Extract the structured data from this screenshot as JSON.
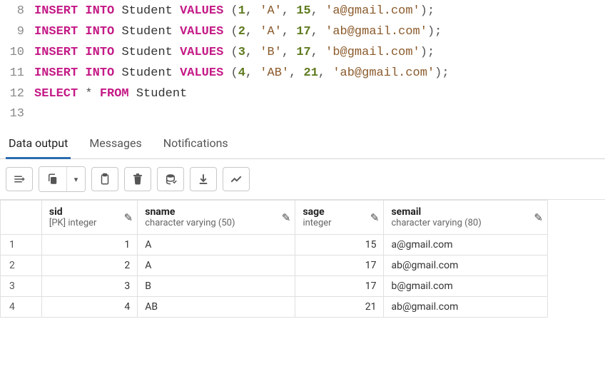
{
  "editor": {
    "lines": [
      {
        "n": 8,
        "tokens": [
          {
            "t": "INSERT",
            "c": "kw"
          },
          {
            "t": " "
          },
          {
            "t": "INTO",
            "c": "kw"
          },
          {
            "t": " "
          },
          {
            "t": "Student",
            "c": "ident"
          },
          {
            "t": " "
          },
          {
            "t": "VALUES",
            "c": "kw"
          },
          {
            "t": " "
          },
          {
            "t": "(",
            "c": "punct"
          },
          {
            "t": "1",
            "c": "num"
          },
          {
            "t": ", ",
            "c": "punct"
          },
          {
            "t": "'A'",
            "c": "str"
          },
          {
            "t": ", ",
            "c": "punct"
          },
          {
            "t": "15",
            "c": "num"
          },
          {
            "t": ", ",
            "c": "punct"
          },
          {
            "t": "'a@gmail.com'",
            "c": "str"
          },
          {
            "t": ")",
            "c": "punct"
          },
          {
            "t": ";",
            "c": "punct"
          }
        ]
      },
      {
        "n": 9,
        "tokens": [
          {
            "t": "INSERT",
            "c": "kw"
          },
          {
            "t": " "
          },
          {
            "t": "INTO",
            "c": "kw"
          },
          {
            "t": " "
          },
          {
            "t": "Student",
            "c": "ident"
          },
          {
            "t": " "
          },
          {
            "t": "VALUES",
            "c": "kw"
          },
          {
            "t": " "
          },
          {
            "t": "(",
            "c": "punct"
          },
          {
            "t": "2",
            "c": "num"
          },
          {
            "t": ", ",
            "c": "punct"
          },
          {
            "t": "'A'",
            "c": "str"
          },
          {
            "t": ", ",
            "c": "punct"
          },
          {
            "t": "17",
            "c": "num"
          },
          {
            "t": ", ",
            "c": "punct"
          },
          {
            "t": "'ab@gmail.com'",
            "c": "str"
          },
          {
            "t": ")",
            "c": "punct"
          },
          {
            "t": ";",
            "c": "punct"
          }
        ]
      },
      {
        "n": 10,
        "tokens": [
          {
            "t": "INSERT",
            "c": "kw"
          },
          {
            "t": " "
          },
          {
            "t": "INTO",
            "c": "kw"
          },
          {
            "t": " "
          },
          {
            "t": "Student",
            "c": "ident"
          },
          {
            "t": " "
          },
          {
            "t": "VALUES",
            "c": "kw"
          },
          {
            "t": " "
          },
          {
            "t": "(",
            "c": "punct"
          },
          {
            "t": "3",
            "c": "num"
          },
          {
            "t": ", ",
            "c": "punct"
          },
          {
            "t": "'B'",
            "c": "str"
          },
          {
            "t": ", ",
            "c": "punct"
          },
          {
            "t": "17",
            "c": "num"
          },
          {
            "t": ", ",
            "c": "punct"
          },
          {
            "t": "'b@gmail.com'",
            "c": "str"
          },
          {
            "t": ")",
            "c": "punct"
          },
          {
            "t": ";",
            "c": "punct"
          }
        ]
      },
      {
        "n": 11,
        "tokens": [
          {
            "t": "INSERT",
            "c": "kw"
          },
          {
            "t": " "
          },
          {
            "t": "INTO",
            "c": "kw"
          },
          {
            "t": " "
          },
          {
            "t": "Student",
            "c": "ident"
          },
          {
            "t": " "
          },
          {
            "t": "VALUES",
            "c": "kw"
          },
          {
            "t": " "
          },
          {
            "t": "(",
            "c": "punct"
          },
          {
            "t": "4",
            "c": "num"
          },
          {
            "t": ", ",
            "c": "punct"
          },
          {
            "t": "'AB'",
            "c": "str"
          },
          {
            "t": ", ",
            "c": "punct"
          },
          {
            "t": "21",
            "c": "num"
          },
          {
            "t": ", ",
            "c": "punct"
          },
          {
            "t": "'ab@gmail.com'",
            "c": "str"
          },
          {
            "t": ")",
            "c": "punct"
          },
          {
            "t": ";",
            "c": "punct"
          }
        ]
      },
      {
        "n": 12,
        "tokens": [
          {
            "t": "SELECT",
            "c": "kw"
          },
          {
            "t": " "
          },
          {
            "t": "*",
            "c": "op"
          },
          {
            "t": " "
          },
          {
            "t": "FROM",
            "c": "kw"
          },
          {
            "t": " "
          },
          {
            "t": "Student",
            "c": "ident"
          }
        ]
      },
      {
        "n": 13,
        "tokens": []
      }
    ]
  },
  "tabs": {
    "items": [
      "Data output",
      "Messages",
      "Notifications"
    ],
    "active": 0
  },
  "toolbar": {
    "addrow_title": "Add row",
    "copy_title": "Copy",
    "dropdown_title": "Copy options",
    "paste_title": "Paste",
    "delete_title": "Delete",
    "savechanges_title": "Save data changes",
    "download_title": "Download",
    "chart_title": "Graph visualizer"
  },
  "columns": [
    {
      "name": "sid",
      "type": "[PK] integer",
      "numeric": true,
      "cls": "col-sid"
    },
    {
      "name": "sname",
      "type": "character varying (50)",
      "numeric": false,
      "cls": "col-sname"
    },
    {
      "name": "sage",
      "type": "integer",
      "numeric": true,
      "cls": "col-sage"
    },
    {
      "name": "semail",
      "type": "character varying (80)",
      "numeric": false,
      "cls": "col-semail"
    }
  ],
  "rows": [
    {
      "n": 1,
      "sid": 1,
      "sname": "A",
      "sage": 15,
      "semail": "a@gmail.com"
    },
    {
      "n": 2,
      "sid": 2,
      "sname": "A",
      "sage": 17,
      "semail": "ab@gmail.com"
    },
    {
      "n": 3,
      "sid": 3,
      "sname": "B",
      "sage": 17,
      "semail": "b@gmail.com"
    },
    {
      "n": 4,
      "sid": 4,
      "sname": "AB",
      "sage": 21,
      "semail": "ab@gmail.com"
    }
  ]
}
